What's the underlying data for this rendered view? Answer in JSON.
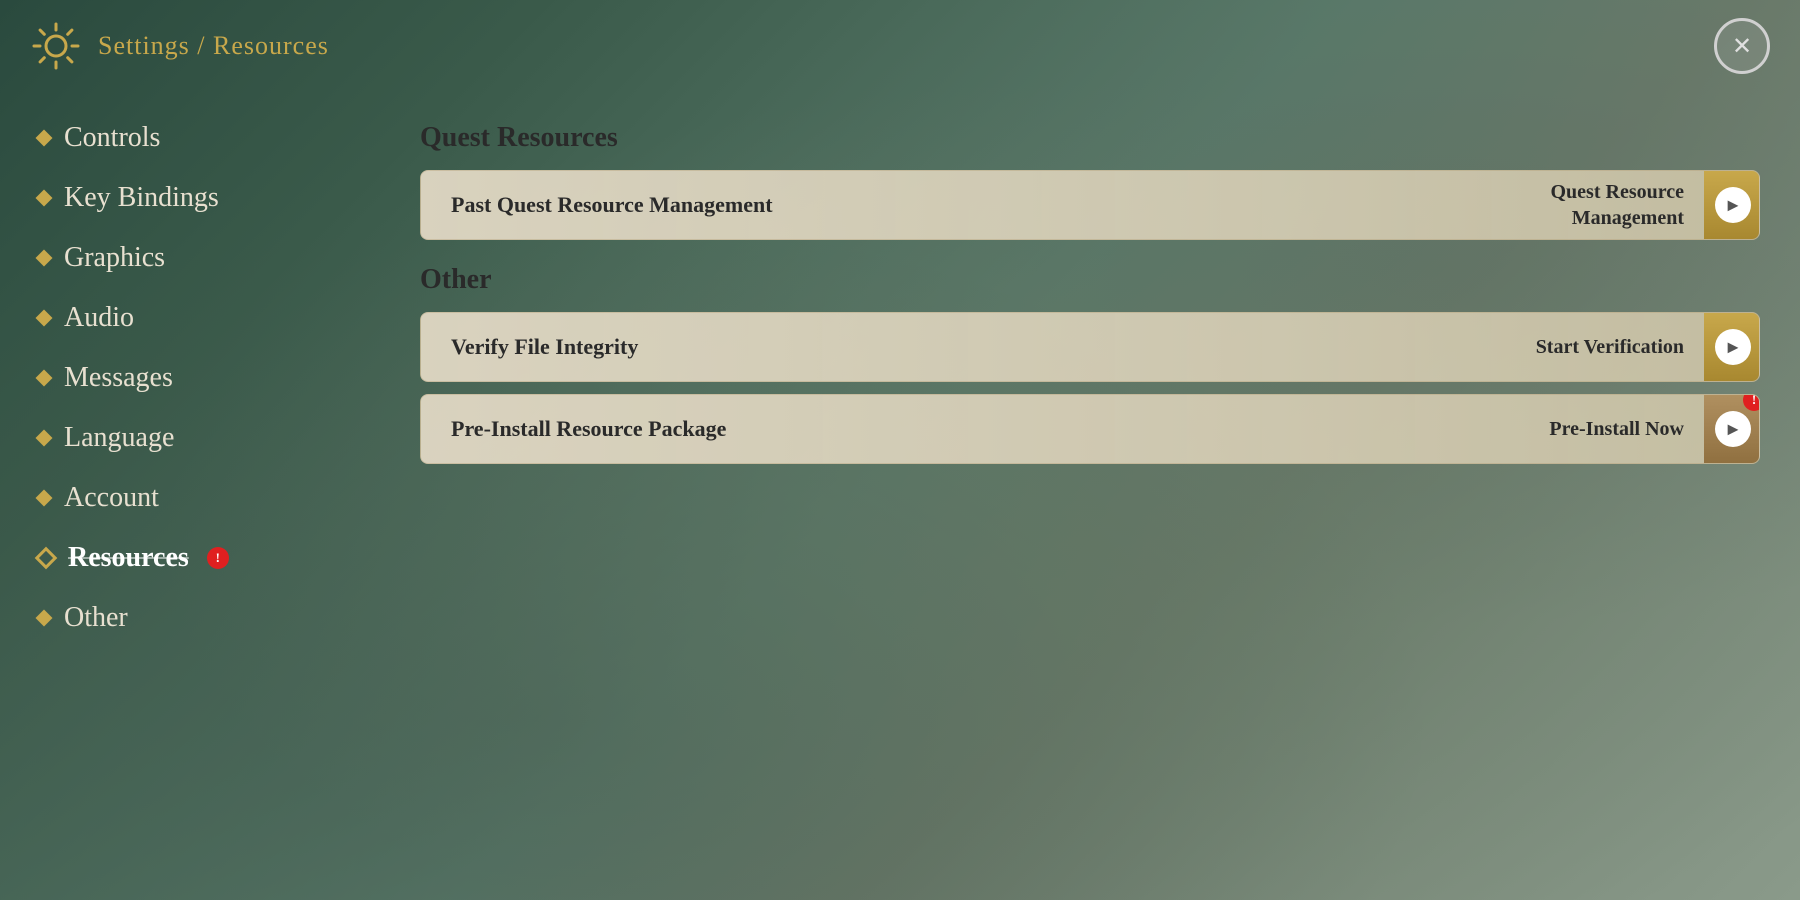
{
  "header": {
    "title": "Settings / Resources",
    "close_label": "✕"
  },
  "sidebar": {
    "items": [
      {
        "id": "controls",
        "label": "Controls",
        "active": false,
        "badge": false
      },
      {
        "id": "key-bindings",
        "label": "Key Bindings",
        "active": false,
        "badge": false
      },
      {
        "id": "graphics",
        "label": "Graphics",
        "active": false,
        "badge": false
      },
      {
        "id": "audio",
        "label": "Audio",
        "active": false,
        "badge": false
      },
      {
        "id": "messages",
        "label": "Messages",
        "active": false,
        "badge": false
      },
      {
        "id": "language",
        "label": "Language",
        "active": false,
        "badge": false
      },
      {
        "id": "account",
        "label": "Account",
        "active": false,
        "badge": false
      },
      {
        "id": "resources",
        "label": "Resources",
        "active": true,
        "badge": true
      },
      {
        "id": "other",
        "label": "Other",
        "active": false,
        "badge": false
      }
    ]
  },
  "content": {
    "quest_section": {
      "title": "Quest Resources",
      "rows": [
        {
          "id": "past-quest",
          "left_label": "Past Quest Resource Management",
          "right_label_line1": "Quest Resource",
          "right_label_line2": "Management",
          "two_line": true
        }
      ]
    },
    "other_section": {
      "title": "Other",
      "rows": [
        {
          "id": "verify",
          "left_label": "Verify File Integrity",
          "right_label": "Start Verification",
          "two_line": false,
          "error": false
        },
        {
          "id": "pre-install",
          "left_label": "Pre-Install Resource Package",
          "right_label": "Pre-Install Now",
          "two_line": false,
          "error": true
        }
      ]
    }
  }
}
